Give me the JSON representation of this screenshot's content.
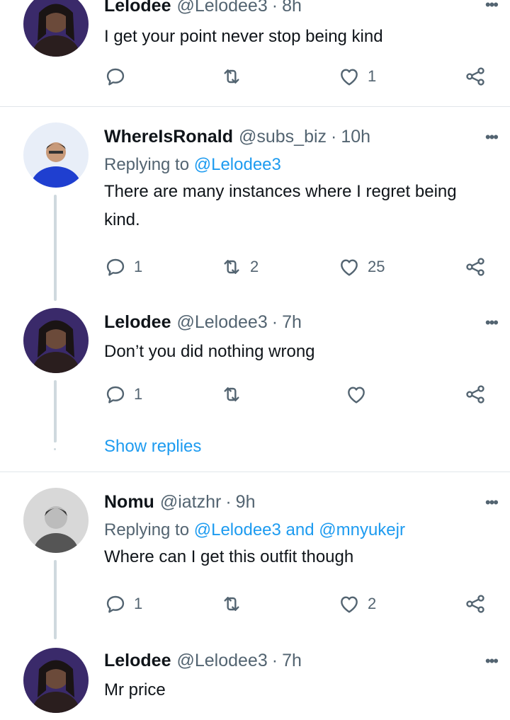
{
  "tweets": [
    {
      "name": "Lelodee",
      "handle": "@Lelodee3",
      "time": "8h",
      "text": "I get your point never stop being kind",
      "reply": "",
      "retweet": "",
      "like": "1"
    },
    {
      "name": "WhereIsRonald",
      "handle": "@subs_biz",
      "time": "10h",
      "replying_prefix": "Replying to",
      "replying_to": "@Lelodee3",
      "text": "There are many instances where I regret being kind.",
      "reply": "1",
      "retweet": "2",
      "like": "25"
    },
    {
      "name": "Lelodee",
      "handle": "@Lelodee3",
      "time": "7h",
      "text": "Don’t you did nothing wrong",
      "reply": "1",
      "retweet": "",
      "like": ""
    },
    {
      "name": "Nomu",
      "handle": "@iatzhr",
      "time": "9h",
      "replying_prefix": "Replying to",
      "replying_to": "@Lelodee3 and @mnyukejr",
      "text": "Where can I get this outfit though",
      "reply": "1",
      "retweet": "",
      "like": "2"
    },
    {
      "name": "Lelodee",
      "handle": "@Lelodee3",
      "time": "7h",
      "text": "Mr price"
    }
  ],
  "show_replies": "Show replies",
  "separator": "·",
  "more_glyph": "•••",
  "colors": {
    "link": "#1d9bf0",
    "secondary_text": "#536471",
    "thread_line": "#cfd9de",
    "divider": "#e1e6ea"
  },
  "icons": [
    "reply-icon",
    "retweet-icon",
    "like-icon",
    "share-icon",
    "more-icon"
  ]
}
